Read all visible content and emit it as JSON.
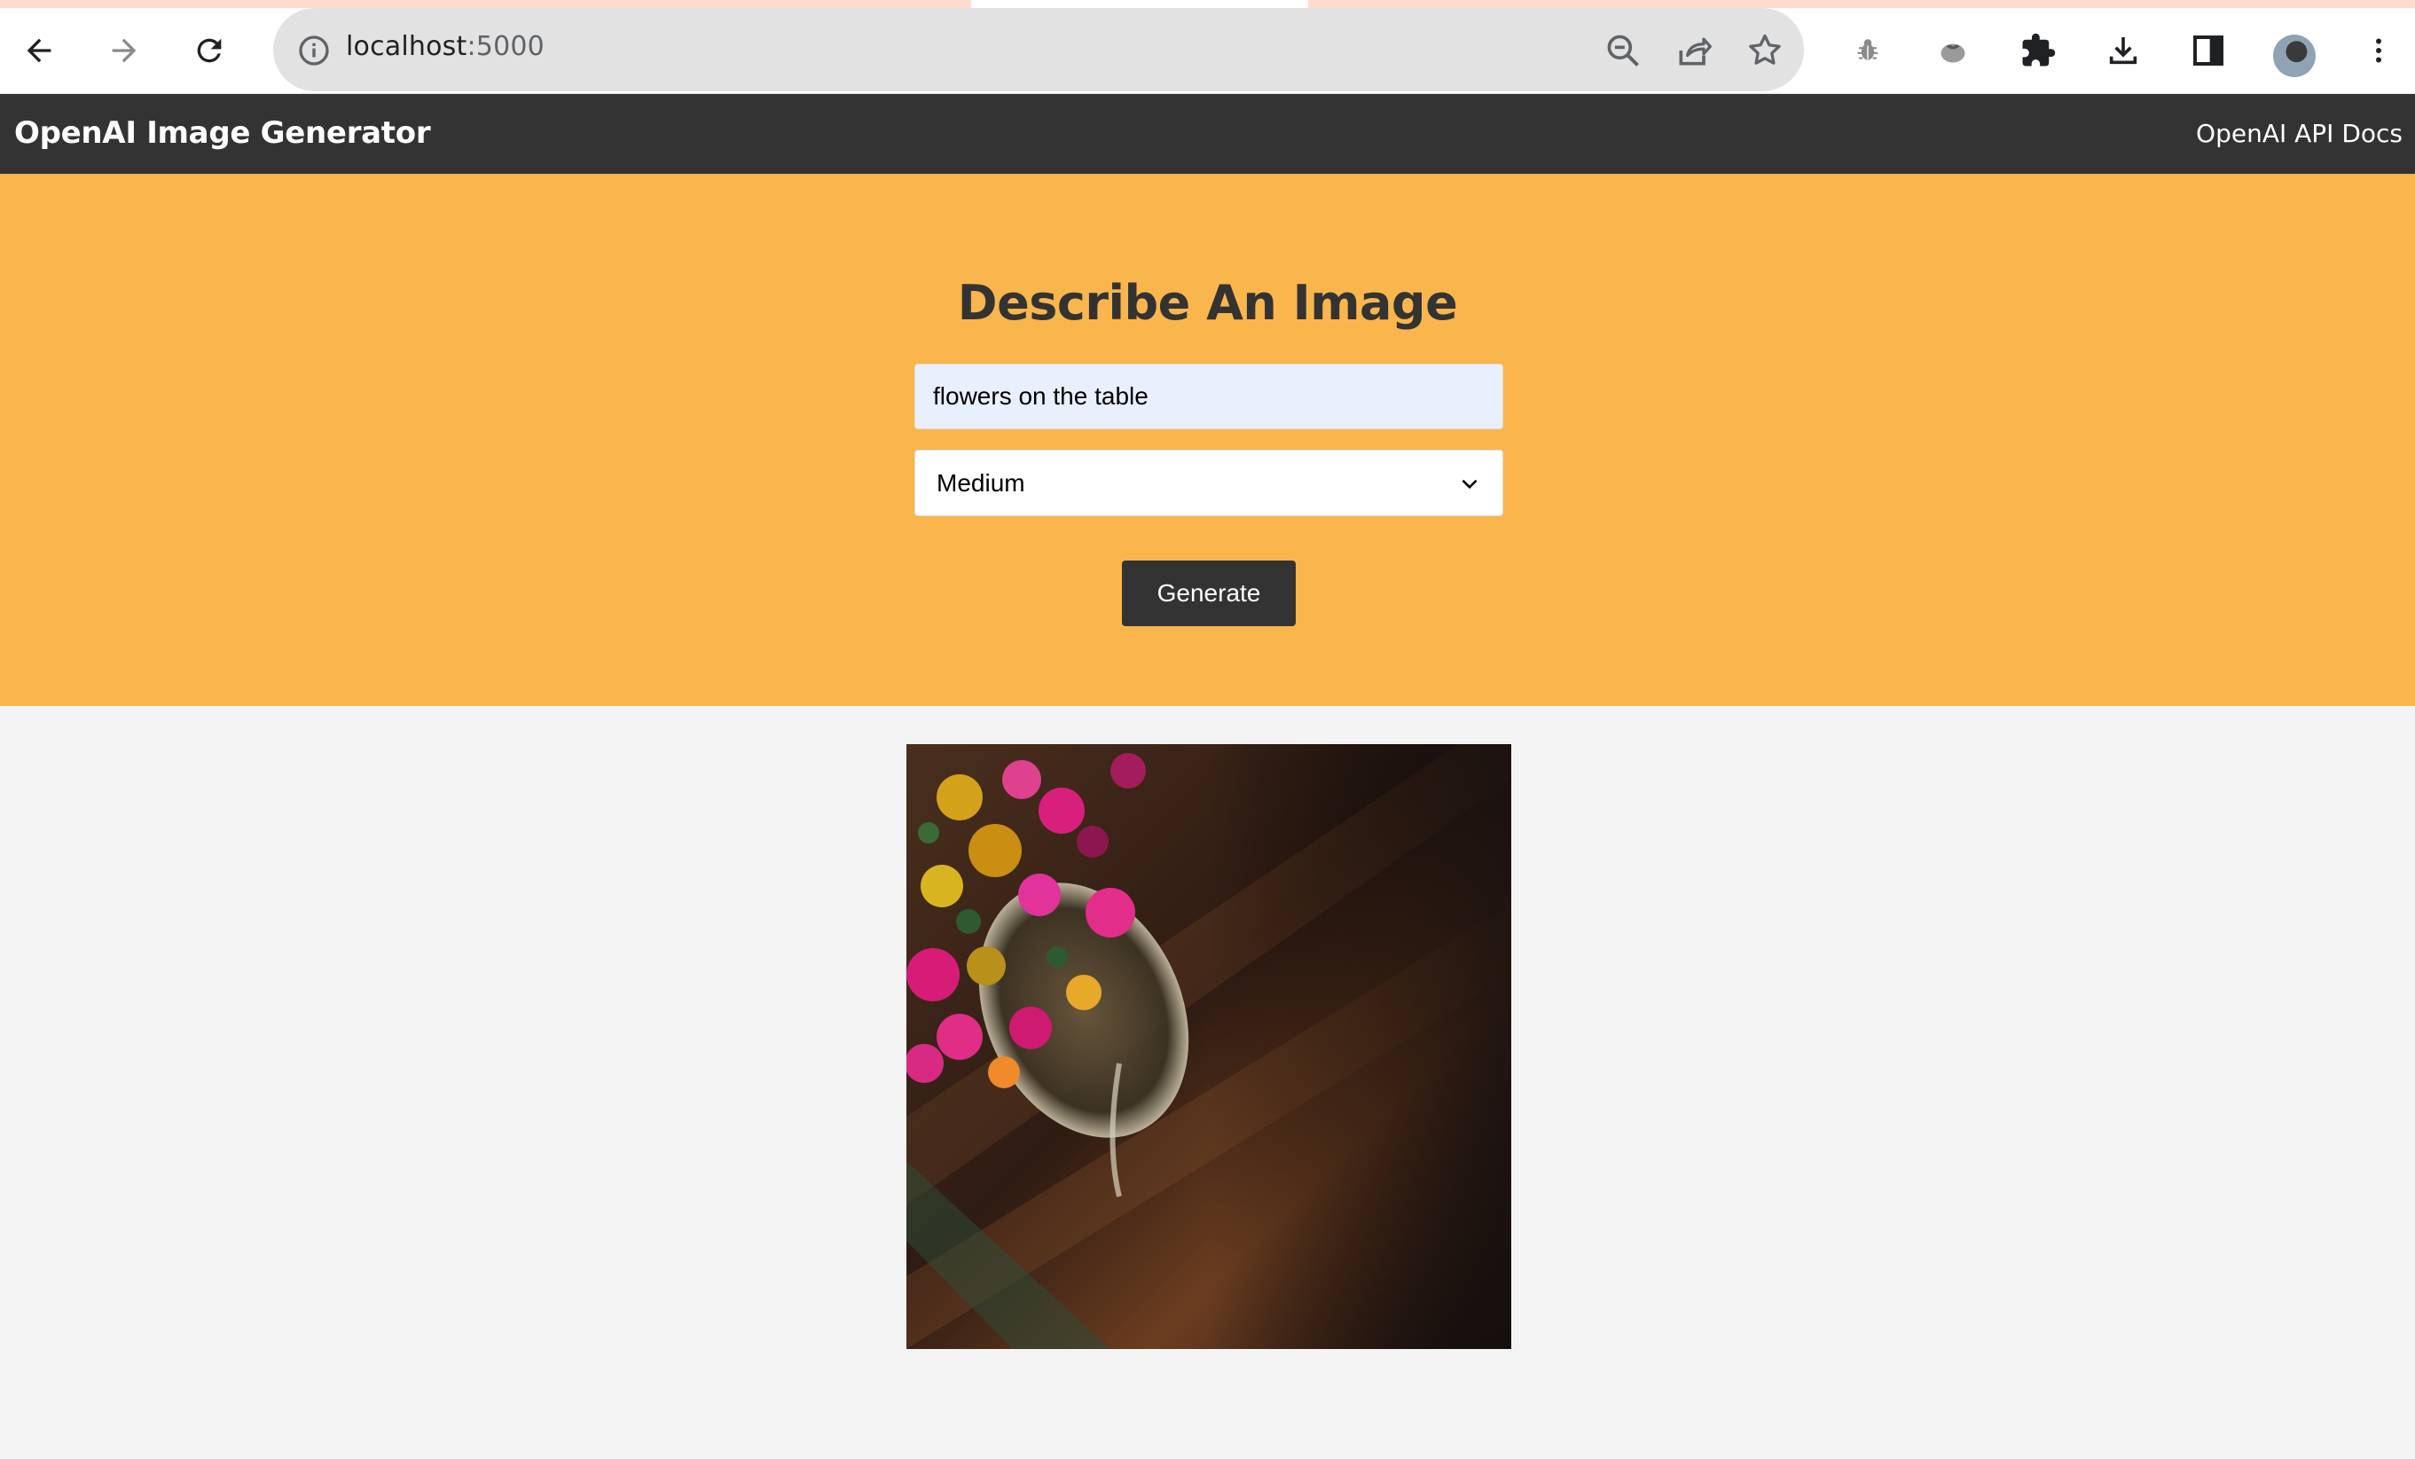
{
  "browser": {
    "url_host": "localhost",
    "url_port": ":5000",
    "icons": [
      "back-icon",
      "forward-icon",
      "reload-icon",
      "info-icon",
      "zoom-out-icon",
      "share-icon",
      "bookmark-star-icon",
      "bug-extension-icon",
      "tomato-extension-icon",
      "puzzle-extensions-icon",
      "download-icon",
      "side-panel-icon",
      "profile-avatar",
      "more-menu-icon"
    ]
  },
  "navbar": {
    "brand": "OpenAI Image Generator",
    "docs_link": "OpenAI API Docs"
  },
  "showcase": {
    "heading": "Describe An Image",
    "prompt_value": "flowers on the table",
    "size_selected": "Medium",
    "generate_label": "Generate"
  },
  "result": {
    "image_subject": "flowers in a glass jar on a wooden table"
  },
  "colors": {
    "navbar": "#333333",
    "showcase": "#f8b64c",
    "page_bg": "#f4f4f4",
    "input_autofill": "#e8f0fe"
  }
}
